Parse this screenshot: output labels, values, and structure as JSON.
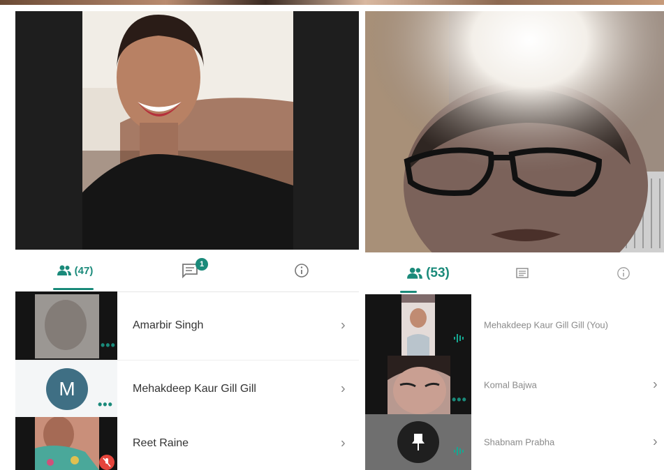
{
  "left_panel": {
    "tabs": {
      "people_count": "(47)",
      "chat_badge": "1"
    },
    "participants": [
      {
        "name": "Amarbir Singh"
      },
      {
        "name": "Mehakdeep Kaur Gill Gill",
        "avatar_letter": "M"
      },
      {
        "name": "Reet Raine"
      }
    ]
  },
  "right_panel": {
    "tabs": {
      "people_count": "(53)"
    },
    "participants": [
      {
        "name": "Mehakdeep Kaur Gill Gill (You)"
      },
      {
        "name": "Komal Bajwa"
      },
      {
        "name": "Shabnam Prabha"
      }
    ]
  },
  "glyphs": {
    "chevron": "›",
    "more": "•••"
  },
  "colors": {
    "accent": "#1a8a7a",
    "avatar_bg": "#3f6f84",
    "mute_red": "#e5453c"
  },
  "icons": [
    "people-icon",
    "chat-icon",
    "info-icon",
    "more-icon",
    "chevron-right-icon",
    "microphone-off-icon",
    "pin-icon",
    "audio-level-icon"
  ]
}
